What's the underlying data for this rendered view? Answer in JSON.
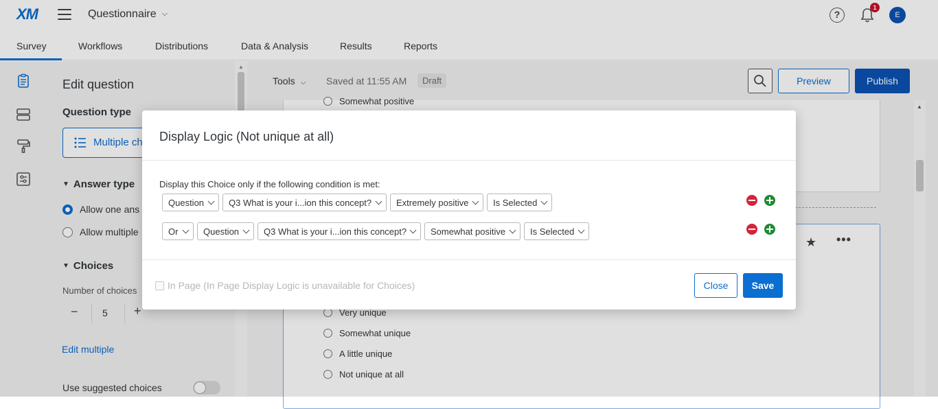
{
  "header": {
    "logo": "XM",
    "project_name": "Questionnaire",
    "notification_count": "1",
    "avatar_initial": "E"
  },
  "tabs": [
    {
      "label": "Survey",
      "active": true
    },
    {
      "label": "Workflows"
    },
    {
      "label": "Distributions"
    },
    {
      "label": "Data & Analysis"
    },
    {
      "label": "Results"
    },
    {
      "label": "Reports"
    }
  ],
  "edit_panel": {
    "title": "Edit question",
    "question_type_label": "Question type",
    "question_type_value": "Multiple ch",
    "answer_type_label": "Answer type",
    "answer_options": [
      "Allow one ans",
      "Allow multiple"
    ],
    "choices_label": "Choices",
    "number_of_choices_label": "Number of choices",
    "number_of_choices": "5",
    "edit_multiple": "Edit multiple",
    "use_suggested": "Use suggested choices"
  },
  "toolbar": {
    "tools_label": "Tools",
    "saved_text": "Saved at 11:55 AM",
    "draft_label": "Draft",
    "preview_label": "Preview",
    "publish_label": "Publish"
  },
  "survey": {
    "top_option": "Somewhat positive",
    "options": [
      "Very unique",
      "Somewhat unique",
      "A little unique",
      "Not unique at all"
    ]
  },
  "modal": {
    "title": "Display Logic (Not unique at all)",
    "condition_label": "Display this Choice only if the following condition is met:",
    "row1": {
      "type": "Question",
      "question": "Q3 What is your i...ion this concept?",
      "choice": "Extremely positive",
      "operator": "Is Selected"
    },
    "row2": {
      "conjunction": "Or",
      "type": "Question",
      "question": "Q3 What is your i...ion this concept?",
      "choice": "Somewhat positive",
      "operator": "Is Selected"
    },
    "in_page_label": "In Page (In Page Display Logic is unavailable for Choices)",
    "close_label": "Close",
    "save_label": "Save"
  },
  "colors": {
    "accent": "#0b6ed1",
    "publish": "#0b53b3",
    "remove": "#d5233a",
    "add": "#1e8a32",
    "badge": "#c5132b"
  }
}
